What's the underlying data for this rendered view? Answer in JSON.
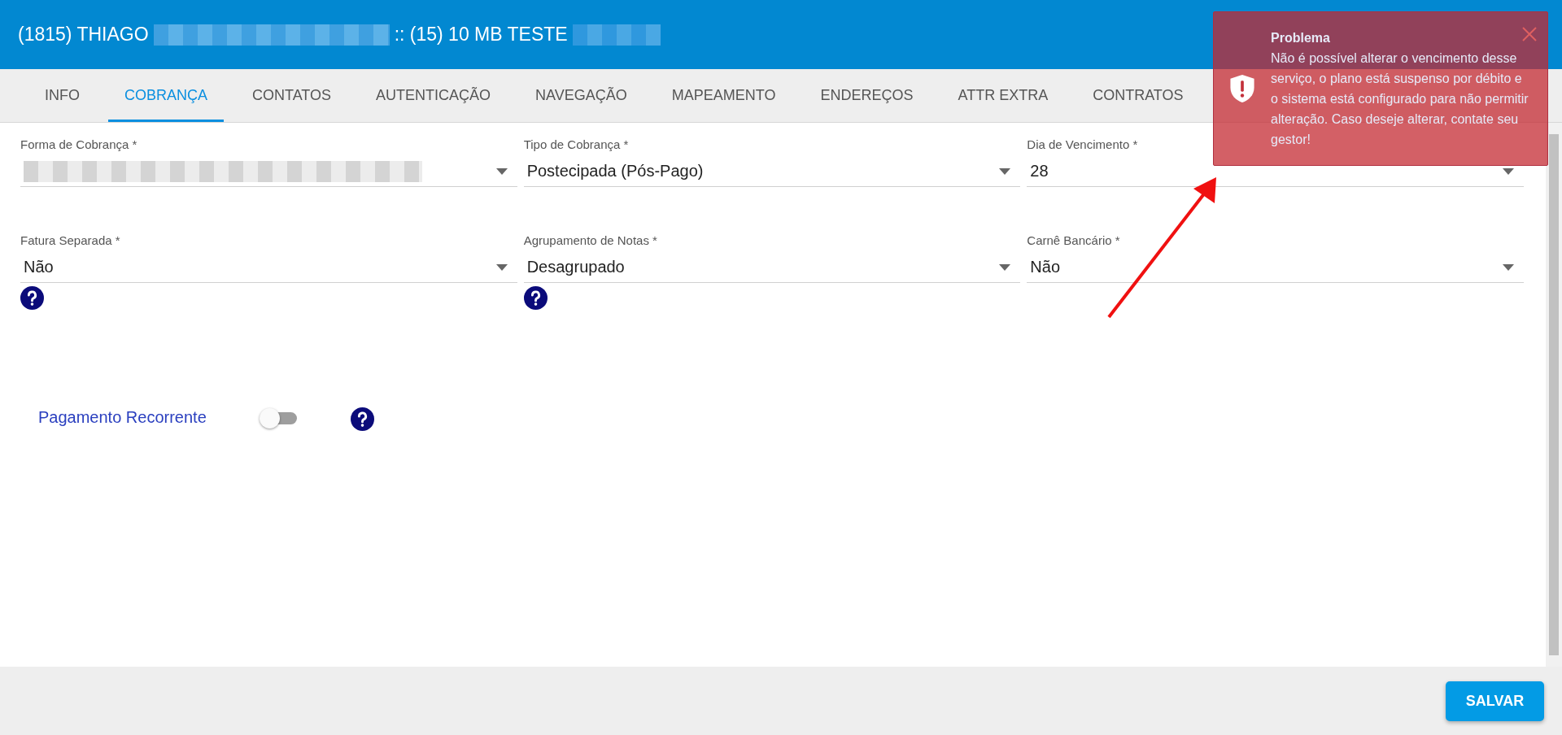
{
  "header": {
    "title_start": "(1815) THIAGO",
    "title_end": ":: (15) 10 MB TESTE"
  },
  "tabs": [
    {
      "label": "INFO",
      "selected": false
    },
    {
      "label": "COBRANÇA",
      "selected": true
    },
    {
      "label": "CONTATOS",
      "selected": false
    },
    {
      "label": "AUTENTICAÇÃO",
      "selected": false
    },
    {
      "label": "NAVEGAÇÃO",
      "selected": false
    },
    {
      "label": "MAPEAMENTO",
      "selected": false
    },
    {
      "label": "ENDEREÇOS",
      "selected": false
    },
    {
      "label": "ATTR EXTRA",
      "selected": false
    },
    {
      "label": "CONTRATOS",
      "selected": false
    }
  ],
  "fields": [
    {
      "label": "Forma de Cobrança *",
      "value_redacted": true,
      "help": false
    },
    {
      "label": "Tipo de Cobrança *",
      "value": "Postecipada (Pós-Pago)",
      "help": false
    },
    {
      "label": "Dia de Vencimento *",
      "value": "28",
      "help": false
    },
    {
      "label": "Fatura Separada *",
      "value": "Não",
      "help": true
    },
    {
      "label": "Agrupamento de Notas *",
      "value": "Desagrupado",
      "help": true
    },
    {
      "label": "Carnê Bancário *",
      "value": "Não",
      "help": false
    }
  ],
  "recurring_payment": {
    "label": "Pagamento Recorrente",
    "on": false
  },
  "footer": {
    "save_button": "SALVAR"
  },
  "toast": {
    "title": "Problema",
    "message": "Não é possível alterar o vencimento desse serviço, o plano está suspenso por débito e o sistema está configurado para não permitir alteração. Caso deseje alterar, contate seu gestor!"
  }
}
